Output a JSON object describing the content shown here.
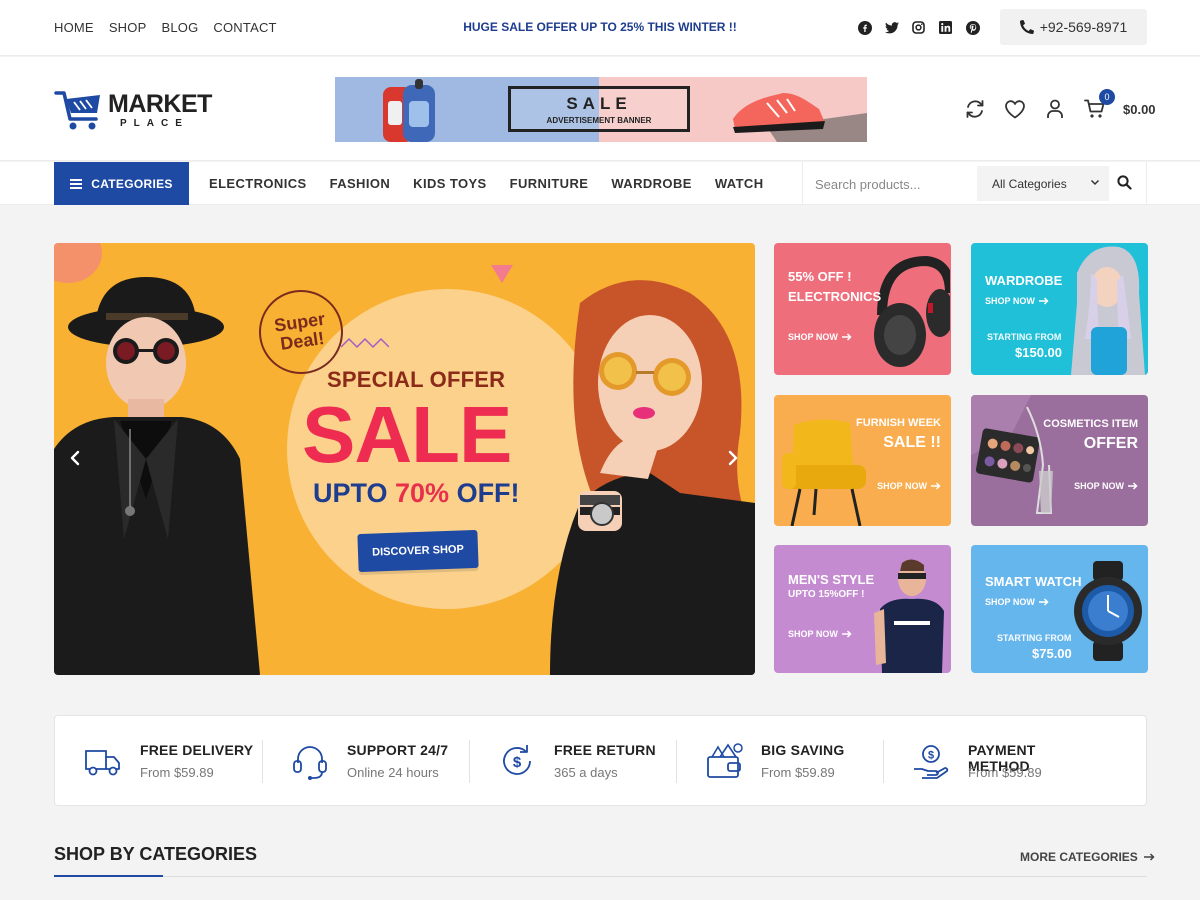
{
  "topbar": {
    "nav": [
      "HOME",
      "SHOP",
      "BLOG",
      "CONTACT"
    ],
    "promo": "HUGE SALE OFFER UP TO 25% THIS WINTER !!",
    "social_icons": [
      "facebook-icon",
      "twitter-icon",
      "instagram-icon",
      "linkedin-icon",
      "pinterest-icon"
    ],
    "phone": "+92-569-8971"
  },
  "header": {
    "logo_main": "MARKET",
    "logo_sub": "PLACE",
    "ad_title": "SALE",
    "ad_subtitle": "ADVERTISEMENT BANNER",
    "cart_count": "0",
    "cart_total": "$0.00"
  },
  "navbar": {
    "categories_label": "CATEGORIES",
    "items": [
      "ELECTRONICS",
      "FASHION",
      "KIDS TOYS",
      "FURNITURE",
      "WARDROBE",
      "WATCH"
    ],
    "search_placeholder": "Search products...",
    "category_select": "All Categories"
  },
  "hero": {
    "badge_line1": "Super",
    "badge_line2": "Deal!",
    "special": "SPECIAL OFFER",
    "sale": "SALE",
    "upto_pre": "UPTO ",
    "upto_pct": "70%",
    "upto_post": " OFF!",
    "cta": "DISCOVER SHOP"
  },
  "tiles": [
    {
      "line1": "55% OFF !",
      "line2": "ELECTRONICS",
      "shop": "SHOP NOW",
      "color": "#ee6f7b"
    },
    {
      "line1": "WARDROBE",
      "shop": "SHOP NOW",
      "from": "STARTING FROM",
      "price": "$150.00",
      "color": "#1fc0d8"
    },
    {
      "line1": "FURNISH WEEK",
      "line2": "SALE !!",
      "shop": "SHOP NOW",
      "color": "#f9ad4e"
    },
    {
      "line1": "COSMETICS ITEM",
      "line2": "OFFER",
      "shop": "SHOP NOW",
      "color": "#9b6f9d"
    },
    {
      "line1": "MEN'S STYLE",
      "line2": "UPTO 15%OFF !",
      "shop": "SHOP NOW",
      "color": "#c58bd1"
    },
    {
      "line1": "SMART WATCH",
      "shop": "SHOP NOW",
      "from": "STARTING FROM",
      "price": "$75.00",
      "color": "#66b6ee"
    }
  ],
  "features": [
    {
      "title": "FREE DELIVERY",
      "sub": "From $59.89",
      "icon": "truck-icon"
    },
    {
      "title": "SUPPORT 24/7",
      "sub": "Online 24 hours",
      "icon": "headset-icon"
    },
    {
      "title": "FREE RETURN",
      "sub": "365 a days",
      "icon": "return-icon"
    },
    {
      "title": "BIG SAVING",
      "sub": "From $59.89",
      "icon": "wallet-icon"
    },
    {
      "title": "PAYMENT METHOD",
      "sub": "From $59.89",
      "icon": "payment-icon"
    }
  ],
  "section": {
    "title": "SHOP BY CATEGORIES",
    "more": "MORE CATEGORIES"
  },
  "colors": {
    "accent": "#1e4aa3",
    "hero_bg": "#f8b133",
    "sale_red": "#ee2c52"
  }
}
